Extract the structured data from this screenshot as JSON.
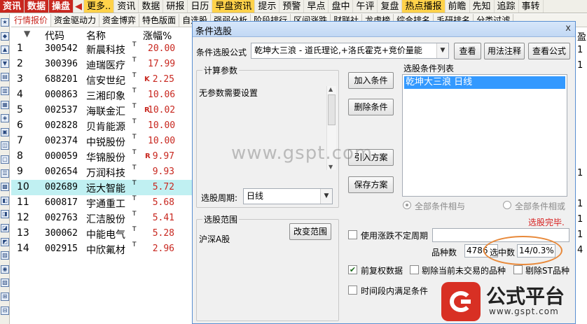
{
  "topbar": {
    "items": [
      {
        "label": "资讯",
        "style": "red"
      },
      {
        "label": "数据",
        "style": "red"
      },
      {
        "label": "操盘",
        "style": "red"
      },
      {
        "label": "更多..",
        "style": "hl"
      },
      {
        "label": "资讯",
        "style": ""
      },
      {
        "label": "数据",
        "style": ""
      },
      {
        "label": "研报",
        "style": ""
      },
      {
        "label": "日历",
        "style": ""
      },
      {
        "label": "早盘资讯",
        "style": "hl"
      },
      {
        "label": "提示",
        "style": ""
      },
      {
        "label": "预警",
        "style": ""
      },
      {
        "label": "早点",
        "style": ""
      },
      {
        "label": "盘中",
        "style": ""
      },
      {
        "label": "午评",
        "style": ""
      },
      {
        "label": "复盘",
        "style": ""
      },
      {
        "label": "热点播报",
        "style": "hl"
      },
      {
        "label": "前瞻",
        "style": ""
      },
      {
        "label": "先知",
        "style": ""
      },
      {
        "label": "追踪",
        "style": ""
      },
      {
        "label": "事转",
        "style": ""
      }
    ],
    "arrow": "◀"
  },
  "tabbar": {
    "tabs": [
      "行情报价",
      "资金驱动力",
      "资金博弈",
      "特色版面",
      "自选股",
      "强弱分析",
      "阶段排行",
      "区间涨跌",
      "财联社",
      "龙虎榜",
      "综合排名",
      "毛研排名",
      "分类过滤"
    ],
    "active_index": 0
  },
  "table": {
    "headers": {
      "idx": "",
      "code": "代码",
      "name": "名称",
      "pct": "涨幅%"
    },
    "rows": [
      {
        "idx": "1",
        "code": "300542",
        "name": "新晨科技",
        "sup": "T",
        "flag": "",
        "pct": "20.00"
      },
      {
        "idx": "2",
        "code": "300396",
        "name": "迪瑞医疗",
        "sup": "T",
        "flag": "",
        "pct": "17.99"
      },
      {
        "idx": "3",
        "code": "688201",
        "name": "信安世纪",
        "sup": "T",
        "flag": "K",
        "pct": "2.25"
      },
      {
        "idx": "4",
        "code": "000863",
        "name": "三湘印象",
        "sup": "T",
        "flag": "",
        "pct": "10.06"
      },
      {
        "idx": "5",
        "code": "002537",
        "name": "海联金汇",
        "sup": "T",
        "flag": "R",
        "pct": "10.02"
      },
      {
        "idx": "6",
        "code": "002828",
        "name": "贝肯能源",
        "sup": "T",
        "flag": "",
        "pct": "10.00"
      },
      {
        "idx": "7",
        "code": "002374",
        "name": "中锐股份",
        "sup": "T",
        "flag": "",
        "pct": "10.00"
      },
      {
        "idx": "8",
        "code": "000059",
        "name": "华锦股份",
        "sup": "T",
        "flag": "R",
        "pct": "9.97"
      },
      {
        "idx": "9",
        "code": "002654",
        "name": "万润科技",
        "sup": "T",
        "flag": "",
        "pct": "9.93"
      },
      {
        "idx": "10",
        "code": "002689",
        "name": "远大智能",
        "sup": "T",
        "flag": "",
        "pct": "5.72"
      },
      {
        "idx": "11",
        "code": "600817",
        "name": "宇通重工",
        "sup": "T",
        "flag": "",
        "pct": "5.68"
      },
      {
        "idx": "12",
        "code": "002763",
        "name": "汇洁股份",
        "sup": "T",
        "flag": "",
        "pct": "5.41"
      },
      {
        "idx": "13",
        "code": "300062",
        "name": "中能电气",
        "sup": "T",
        "flag": "",
        "pct": "5.28"
      },
      {
        "idx": "14",
        "code": "002915",
        "name": "中欣氟材",
        "sup": "T",
        "flag": "",
        "pct": "2.96"
      }
    ],
    "selected_index": 9,
    "right_partial": [
      "1",
      "1",
      "",
      "",
      "",
      "",
      "",
      "",
      "1",
      "",
      "1",
      "1",
      "1",
      "4"
    ],
    "right_header": "盈"
  },
  "dialog": {
    "title": "条件选股",
    "close_symbol": "x",
    "formula_label": "条件选股公式",
    "formula_value": "乾坤大三浪  - 道氏理论,+洛氏霍克+竞价量能",
    "btn_view": "查看",
    "btn_usage": "用法注释",
    "btn_view_formula": "查看公式",
    "param_group": "计算参数",
    "param_text": "无参数需要设置",
    "btn_add": "加入条件",
    "btn_delete": "删除条件",
    "btn_import": "引入方案",
    "btn_save": "保存方案",
    "list_group": "选股条件列表",
    "list_items": [
      "乾坤大三浪  日线"
    ],
    "period_label": "选股周期:",
    "period_value": "日线",
    "radio_all_and": "全部条件相与",
    "radio_all_or": "全部条件相或",
    "status_text": "选股完毕.",
    "range_group": "选股范围",
    "range_value": "沪深A股",
    "btn_change_range": "改变范围",
    "chk_unfixed_period": "使用涨跌不定周期",
    "chk_unfixed_checked": false,
    "count_label": "品种数",
    "count_value": "4786",
    "selected_label": "选中数",
    "selected_value": "14/0.3%",
    "chk_prev_adj": "前复权数据",
    "chk_prev_adj_checked": true,
    "chk_exclude_untraded": "剔除当前未交易的品种",
    "chk_exclude_untraded_checked": false,
    "chk_exclude_st": "剔除ST品种",
    "chk_exclude_st_checked": false,
    "chk_interval": "时间段内满足条件",
    "chk_interval_checked": false
  },
  "watermark": "www.gspt.com",
  "logo": {
    "name": "公式平台",
    "url": "www.gspt.com"
  }
}
